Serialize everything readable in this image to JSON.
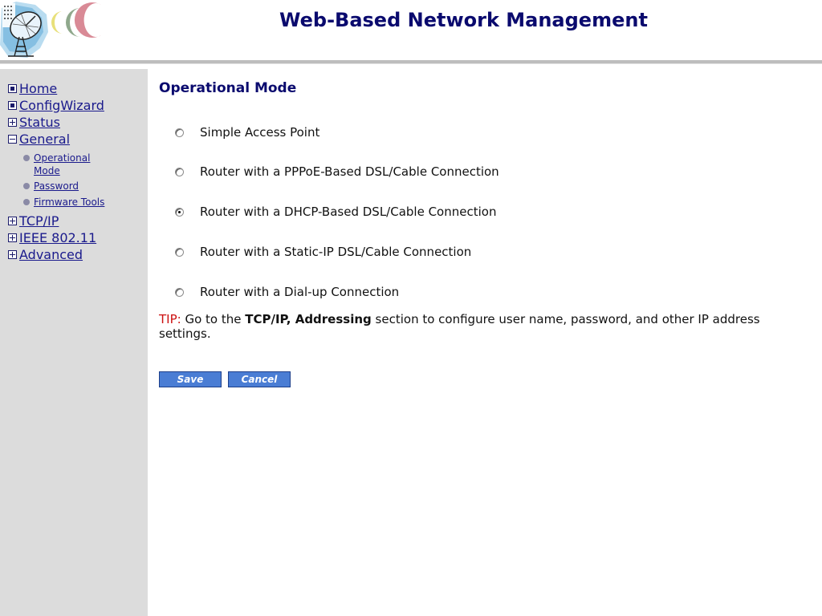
{
  "header": {
    "title": "Web-Based Network Management",
    "logo_icon": "satellite-dish-logo",
    "colors": {
      "title": "#0a0a6e",
      "crescent_yellow": "#e8e07a",
      "crescent_green": "#8fa88c",
      "crescent_pink": "#d98a96"
    }
  },
  "sidebar": {
    "items": [
      {
        "label": "Home",
        "icon": "dot-box-icon"
      },
      {
        "label": "ConfigWizard",
        "icon": "dot-box-icon"
      },
      {
        "label": "Status",
        "icon": "plus-box-icon"
      },
      {
        "label": "General",
        "icon": "minus-box-icon"
      },
      {
        "label": "TCP/IP",
        "icon": "plus-box-icon"
      },
      {
        "label": "IEEE 802.11",
        "icon": "plus-box-icon"
      },
      {
        "label": "Advanced",
        "icon": "plus-box-icon"
      }
    ],
    "general_subitems": [
      {
        "label": "Operational Mode",
        "line1": "Operational",
        "line2": "Mode"
      },
      {
        "label": "Password"
      },
      {
        "label": "Firmware Tools"
      }
    ]
  },
  "main": {
    "title": "Operational Mode",
    "options": [
      {
        "label": "Simple Access Point",
        "selected": false
      },
      {
        "label": "Router with a PPPoE-Based DSL/Cable Connection",
        "selected": false
      },
      {
        "label": "Router with a DHCP-Based DSL/Cable Connection",
        "selected": true
      },
      {
        "label": "Router with a Static-IP DSL/Cable Connection",
        "selected": false
      },
      {
        "label": "Router with a Dial-up Connection",
        "selected": false
      }
    ],
    "tip": {
      "prefix": "TIP:",
      "before": " Go to the ",
      "bold": "TCP/IP, Addressing",
      "after": " section to configure user name, password, and other IP address settings."
    },
    "buttons": {
      "save": "Save",
      "cancel": "Cancel"
    },
    "colors": {
      "tip_prefix": "#cc1111",
      "button_bg": "#4a7dd4"
    }
  }
}
